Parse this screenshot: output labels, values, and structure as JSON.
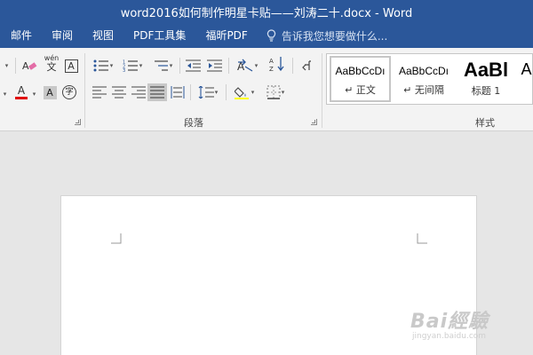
{
  "window": {
    "title": "word2016如何制作明星卡贴——刘涛二十.docx - Word"
  },
  "menu": {
    "items": [
      "邮件",
      "审阅",
      "视图",
      "PDF工具集",
      "福昕PDF"
    ],
    "tell_me_placeholder": "告诉我您想要做什么..."
  },
  "ribbon": {
    "font_group": {
      "pinyin_label": "wén",
      "pinyin_glyph": "文",
      "border_char_label": "A",
      "shading_label": "A",
      "enclose_label": "字",
      "font_color_label": "A",
      "font_color": "#e00000",
      "highlight_color": "#ffff00"
    },
    "paragraph_group": {
      "label": "段落"
    },
    "styles_group": {
      "label": "样式",
      "items": [
        {
          "preview": "AaBbCcDı",
          "name": "↵ 正文"
        },
        {
          "preview": "AaBbCcDı",
          "name": "↵ 无间隔"
        },
        {
          "preview": "AaBl",
          "name": "标题 1"
        },
        {
          "preview": "A",
          "name": ""
        }
      ]
    }
  },
  "watermark": {
    "text": "Bai經驗",
    "sub": "jingyan.baidu.com"
  }
}
